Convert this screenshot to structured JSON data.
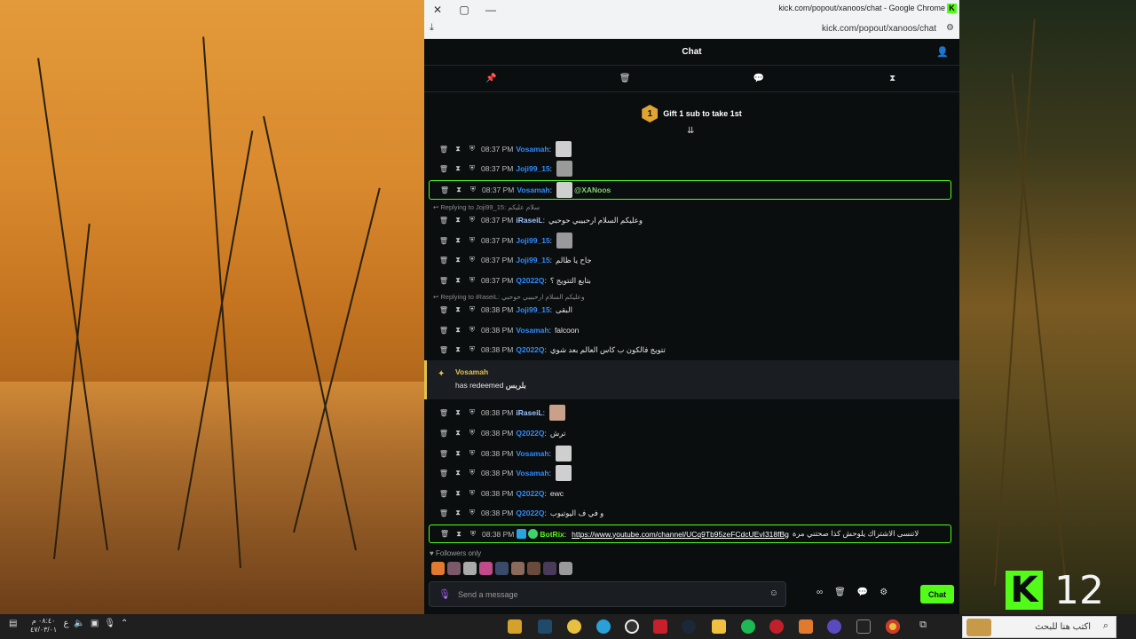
{
  "browser": {
    "title": "kick.com/popout/xanoos/chat - Google Chrome",
    "url": "kick.com/popout/xanoos/chat",
    "close_icon": "✕",
    "maximize_icon": "▢",
    "minimize_icon": "—",
    "favicon": "K"
  },
  "chat": {
    "header_title": "Chat",
    "gift_number": "1",
    "gift_text": "Gift 1 sub to take 1st",
    "messages": [
      {
        "time": "08:37 PM",
        "user": "Vosamah",
        "text": ""
      },
      {
        "time": "08:37 PM",
        "user": "Joji99_15",
        "text": ""
      },
      {
        "time": "08:37 PM",
        "user": "Vosamah",
        "text": "@XANoos"
      },
      {
        "time": "08:37 PM",
        "user": "iRaseiL",
        "text": "وعليكم السلام ارحبيبي حوحبي"
      },
      {
        "time": "08:37 PM",
        "user": "Joji99_15",
        "text": ""
      },
      {
        "time": "08:37 PM",
        "user": "Joji99_15",
        "text": "جاح يا ظالم"
      },
      {
        "time": "08:37 PM",
        "user": "Q2022Q",
        "text": "بتابع التتويج ؟"
      },
      {
        "time": "08:38 PM",
        "user": "Joji99_15",
        "text": "البقى"
      },
      {
        "time": "08:38 PM",
        "user": "Vosamah",
        "text": "falcoon"
      },
      {
        "time": "08:38 PM",
        "user": "Q2022Q",
        "text": "تتويج فالكون ب كاس العالم بعد شوي"
      },
      {
        "time": "08:38 PM",
        "user": "iRaseiL",
        "text": ""
      },
      {
        "time": "08:38 PM",
        "user": "Q2022Q",
        "text": "ترش"
      },
      {
        "time": "08:38 PM",
        "user": "Vosamah",
        "text": ""
      },
      {
        "time": "08:38 PM",
        "user": "Vosamah",
        "text": ""
      },
      {
        "time": "08:38 PM",
        "user": "Q2022Q",
        "text": "ewc"
      },
      {
        "time": "08:38 PM",
        "user": "Q2022Q",
        "text": "و في ف اليوتيوب"
      },
      {
        "time": "08:38 PM",
        "user": "BotRix",
        "text": "https://www.youtube.com/channel/UCq9Tb95zeFCdcUEvI318fBg",
        "suffix": "لاتنسى الاشتراك يلوحش كذا صحتني مرة"
      }
    ],
    "replies": [
      {
        "text": "Replying to Joji99_15:",
        "quote": "سلام عليكم"
      },
      {
        "text": "Replying to iRaseiL:",
        "quote": "وعليكم السلام ارحبيبي حوحبي"
      }
    ],
    "redeem": {
      "user": "Vosamah",
      "text": "has redeemed",
      "reward": "بلربس"
    },
    "followers_only": "Followers only",
    "input_placeholder": "Send a message",
    "chat_button": "Chat"
  },
  "desktop": {
    "badge_letter": "K",
    "badge_number": "12"
  },
  "taskbar": {
    "search_placeholder": "اكتب هنا للبحث",
    "clock_time": "٠٨:٤٠ م",
    "clock_date": "٤٧/٠٣/٠١",
    "lang": "ع"
  },
  "colors": {
    "kick_green": "#53fc18",
    "user_blue": "#2f8cff",
    "mention_green": "#80d16f"
  }
}
